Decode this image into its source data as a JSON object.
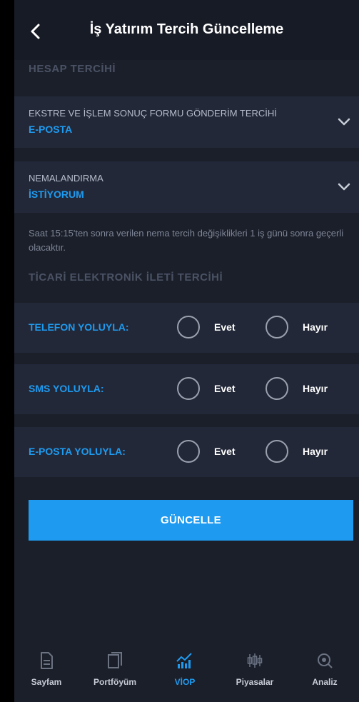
{
  "header": {
    "title": "İş Yatırım Tercih Güncelleme"
  },
  "sections": {
    "account_pref": "HESAP TERCİHİ",
    "commercial_pref": "TİCARİ ELEKTRONİK İLETİ TERCİHİ"
  },
  "dropdowns": [
    {
      "label": "EKSTRE VE İŞLEM SONUÇ FORMU GÖNDERİM TERCİHİ",
      "value": "E-POSTA"
    },
    {
      "label": "NEMALANDIRMA",
      "value": "İSTİYORUM"
    }
  ],
  "note": "Saat 15:15'ten sonra verilen nema tercih değişiklikleri 1 iş günü sonra geçerli olacaktır.",
  "radio_rows": [
    {
      "label": "TELEFON YOLUYLA:",
      "yes": "Evet",
      "no": "Hayır"
    },
    {
      "label": "SMS YOLUYLA:",
      "yes": "Evet",
      "no": "Hayır"
    },
    {
      "label": "E-POSTA YOLUYLA:",
      "yes": "Evet",
      "no": "Hayır"
    }
  ],
  "update_button": "GÜNCELLE",
  "tabbar": {
    "items": [
      {
        "label": "Sayfam",
        "icon": "document-icon"
      },
      {
        "label": "Portföyüm",
        "icon": "portfolio-icon"
      },
      {
        "label": "VİOP",
        "icon": "chart-icon",
        "active": true
      },
      {
        "label": "Piyasalar",
        "icon": "candlestick-icon"
      },
      {
        "label": "Analiz",
        "icon": "magnifier-icon"
      }
    ]
  },
  "colors": {
    "accent": "#1e9bf0",
    "background": "#1b1f2a",
    "panel": "#232838"
  }
}
